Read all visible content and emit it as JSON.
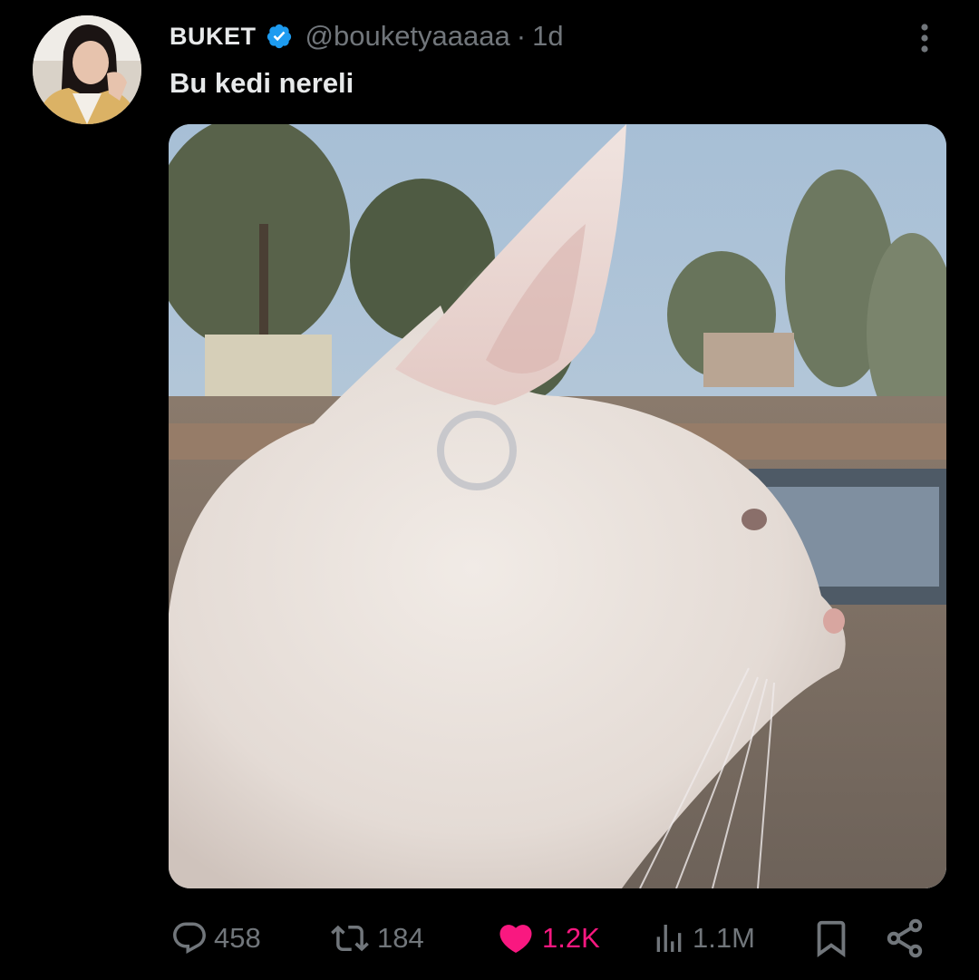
{
  "tweet": {
    "display_name": "BUKET",
    "handle": "@bouketyaaaaa",
    "separator": "·",
    "time": "1d",
    "text": "Bu kedi nereli",
    "verified": true
  },
  "icons": {
    "more": "more-vertical-icon",
    "verified": "verified-badge-icon",
    "reply": "reply-icon",
    "retweet": "retweet-icon",
    "like": "heart-filled-icon",
    "views": "views-chart-icon",
    "bookmark": "bookmark-icon",
    "share": "share-icon"
  },
  "actions": {
    "replies": "458",
    "retweets": "184",
    "likes": "1.2K",
    "views": "1.1M"
  },
  "colors": {
    "background": "#000000",
    "text_primary": "#e7e9ea",
    "text_secondary": "#71767b",
    "verified": "#1d9bf0",
    "like": "#f91880"
  }
}
